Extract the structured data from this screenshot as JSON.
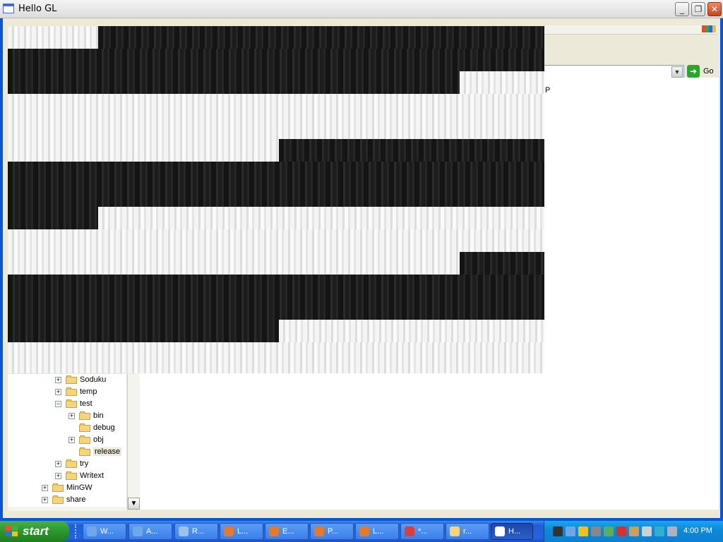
{
  "window": {
    "title": "Hello GL",
    "minimize_glyph": "_",
    "restore_glyph": "❐",
    "close_glyph": "✕"
  },
  "address_bar": {
    "go_label": "Go",
    "go_icon": "green-arrow-icon",
    "peek_text": "P"
  },
  "tree": {
    "items": [
      {
        "label": "Soduku",
        "expander": "+"
      },
      {
        "label": "temp",
        "expander": "+"
      },
      {
        "label": "test",
        "expander": "−"
      },
      {
        "label": "bin",
        "expander": "+"
      },
      {
        "label": "debug",
        "expander": ""
      },
      {
        "label": "obj",
        "expander": "+"
      },
      {
        "label": "release",
        "expander": ""
      },
      {
        "label": "try",
        "expander": "+"
      },
      {
        "label": "Writext",
        "expander": "+"
      },
      {
        "label": "MinGW",
        "expander": "+"
      },
      {
        "label": "share",
        "expander": "+"
      }
    ]
  },
  "taskbar": {
    "start_label": "start",
    "tasks": [
      {
        "label": "W...",
        "icon": "users-icon",
        "color": "#6fa8e8"
      },
      {
        "label": "A...",
        "icon": "users-icon",
        "color": "#6fa8e8"
      },
      {
        "label": "R...",
        "icon": "network-icon",
        "color": "#9fc0e8"
      },
      {
        "label": "L...",
        "icon": "firefox-icon",
        "color": "#e8782a"
      },
      {
        "label": "E...",
        "icon": "firefox-icon",
        "color": "#e8782a"
      },
      {
        "label": "P...",
        "icon": "firefox-icon",
        "color": "#e8782a"
      },
      {
        "label": "L...",
        "icon": "firefox-icon",
        "color": "#e8782a"
      },
      {
        "label": "*...",
        "icon": "paint-icon",
        "color": "#d84040"
      },
      {
        "label": "r...",
        "icon": "folder-icon",
        "color": "#f4d57a"
      },
      {
        "label": "H...",
        "icon": "window-icon",
        "color": "#ffffff"
      }
    ],
    "clock": "4:00 PM"
  }
}
